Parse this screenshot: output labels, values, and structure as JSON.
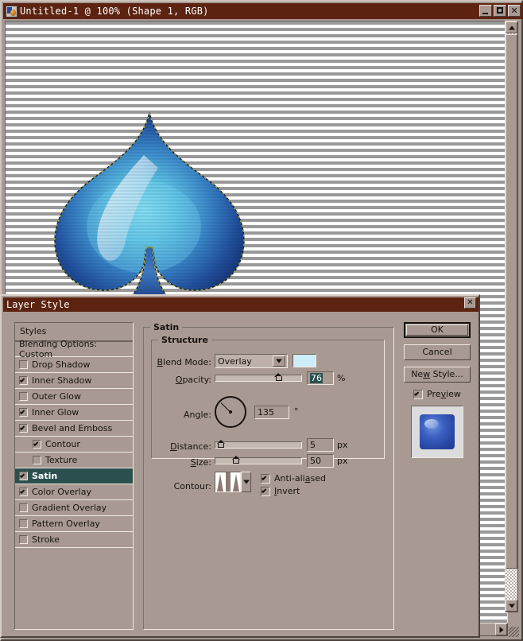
{
  "document_window": {
    "title": "Untitled-1 @ 100% (Shape 1, RGB)",
    "icon": "photoshop-document-icon",
    "controls": {
      "minimize": "_",
      "maximize": "□",
      "close": "✕"
    },
    "canvas": {
      "artwork": "blue-glossy-spade",
      "background_pattern": "horizontal-gray-white-stripes"
    }
  },
  "dialog": {
    "title": "Layer Style",
    "close_label": "✕",
    "styles_panel": {
      "header": "Styles",
      "items": [
        {
          "label": "Blending Options: Custom",
          "checkbox": false,
          "has_checkbox": false,
          "indent": false,
          "selected": false
        },
        {
          "label": "Drop Shadow",
          "checkbox": false,
          "has_checkbox": true,
          "indent": false,
          "selected": false
        },
        {
          "label": "Inner Shadow",
          "checkbox": true,
          "has_checkbox": true,
          "indent": false,
          "selected": false
        },
        {
          "label": "Outer Glow",
          "checkbox": false,
          "has_checkbox": true,
          "indent": false,
          "selected": false
        },
        {
          "label": "Inner Glow",
          "checkbox": true,
          "has_checkbox": true,
          "indent": false,
          "selected": false
        },
        {
          "label": "Bevel and Emboss",
          "checkbox": true,
          "has_checkbox": true,
          "indent": false,
          "selected": false
        },
        {
          "label": "Contour",
          "checkbox": true,
          "has_checkbox": true,
          "indent": true,
          "selected": false
        },
        {
          "label": "Texture",
          "checkbox": false,
          "has_checkbox": true,
          "indent": true,
          "selected": false
        },
        {
          "label": "Satin",
          "checkbox": true,
          "has_checkbox": true,
          "indent": false,
          "selected": true
        },
        {
          "label": "Color Overlay",
          "checkbox": true,
          "has_checkbox": true,
          "indent": false,
          "selected": false
        },
        {
          "label": "Gradient Overlay",
          "checkbox": false,
          "has_checkbox": true,
          "indent": false,
          "selected": false
        },
        {
          "label": "Pattern Overlay",
          "checkbox": false,
          "has_checkbox": true,
          "indent": false,
          "selected": false
        },
        {
          "label": "Stroke",
          "checkbox": false,
          "has_checkbox": true,
          "indent": false,
          "selected": false
        }
      ]
    },
    "settings": {
      "group_title": "Satin",
      "section_title": "Structure",
      "blend_mode": {
        "label": "Blend Mode:",
        "value": "Overlay",
        "color": "#cdeef8"
      },
      "opacity": {
        "label": "Opacity:",
        "value": "76",
        "unit": "%",
        "slider_percent": 76
      },
      "angle": {
        "label": "Angle:",
        "value": "135",
        "unit": "°",
        "degrees": 135
      },
      "distance": {
        "label": "Distance:",
        "value": "5",
        "unit": "px",
        "slider_percent": 3
      },
      "size": {
        "label": "Size:",
        "value": "50",
        "unit": "px",
        "slider_percent": 22
      },
      "contour": {
        "label": "Contour:",
        "shape": "double-peak-w-curve"
      },
      "anti_aliased": {
        "label": "Anti-aliased",
        "checked": true
      },
      "invert": {
        "label": "Invert",
        "checked": true
      }
    },
    "buttons": {
      "ok": "OK",
      "cancel": "Cancel",
      "new_style": "New Style...",
      "preview": {
        "label": "Preview",
        "checked": true
      },
      "preview_thumb": "blue-rounded-square-swatch"
    }
  },
  "colors": {
    "titlebar": "#5c2310",
    "dialog_face": "#a89a92",
    "selection": "#2b4f4f",
    "blend_swatch": "#cdeef8",
    "spade_dark": "#1d3a7a",
    "spade_light": "#6fd2ef"
  }
}
